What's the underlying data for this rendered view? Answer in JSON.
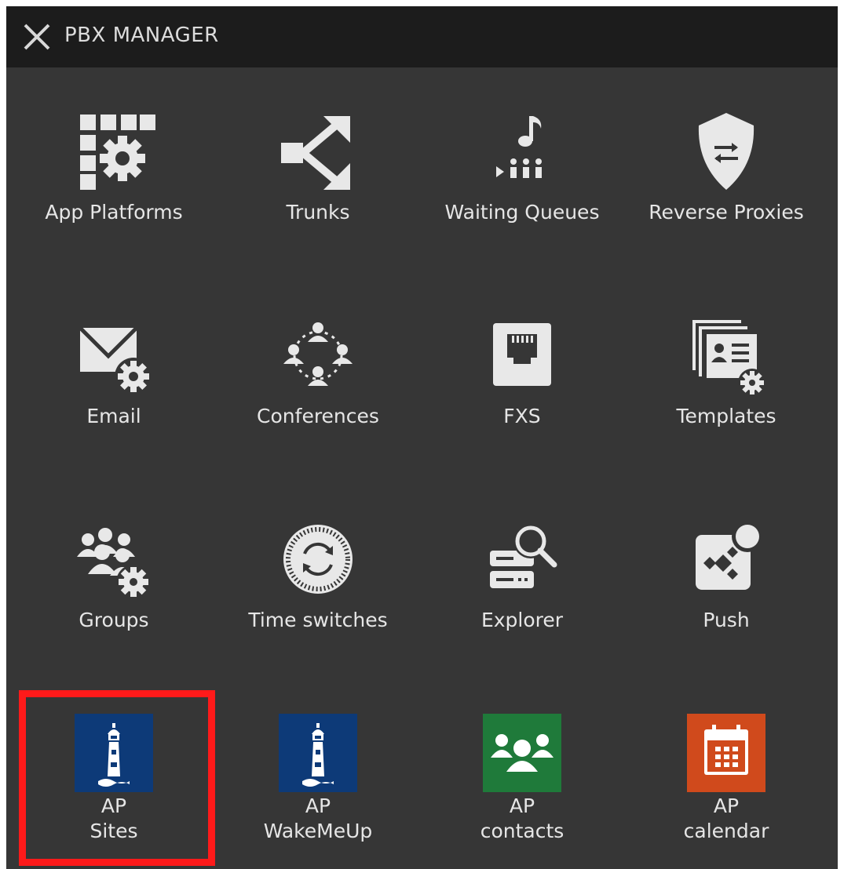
{
  "header": {
    "title": "PBX MANAGER",
    "close_icon": "close-icon"
  },
  "tiles": [
    {
      "label": "App Platforms",
      "icon": "app-platforms-icon"
    },
    {
      "label": "Trunks",
      "icon": "trunks-icon"
    },
    {
      "label": "Waiting Queues",
      "icon": "waiting-queues-icon"
    },
    {
      "label": "Reverse Proxies",
      "icon": "reverse-proxies-icon"
    },
    {
      "label": "Email",
      "icon": "email-icon"
    },
    {
      "label": "Conferences",
      "icon": "conferences-icon"
    },
    {
      "label": "FXS",
      "icon": "fxs-icon"
    },
    {
      "label": "Templates",
      "icon": "templates-icon"
    },
    {
      "label": "Groups",
      "icon": "groups-icon"
    },
    {
      "label": "Time switches",
      "icon": "time-switches-icon"
    },
    {
      "label": "Explorer",
      "icon": "explorer-icon"
    },
    {
      "label": "Push",
      "icon": "push-icon"
    }
  ],
  "app_tiles": [
    {
      "line1": "AP",
      "line2": "Sites",
      "icon": "lighthouse-icon",
      "color": "#0d3a78",
      "selected": true
    },
    {
      "line1": "AP",
      "line2": "WakeMeUp",
      "icon": "lighthouse-icon",
      "color": "#0d3a78",
      "selected": false
    },
    {
      "line1": "AP",
      "line2": "contacts",
      "icon": "contacts-icon",
      "color": "#1f7a3a",
      "selected": false
    },
    {
      "line1": "AP",
      "line2": "calendar",
      "icon": "calendar-icon",
      "color": "#d04a1c",
      "selected": false
    }
  ],
  "colors": {
    "background": "#363636",
    "header": "#1c1c1c",
    "icon": "#e8e8e8",
    "text": "#e6e6e6",
    "selection": "#ff1a1a"
  }
}
